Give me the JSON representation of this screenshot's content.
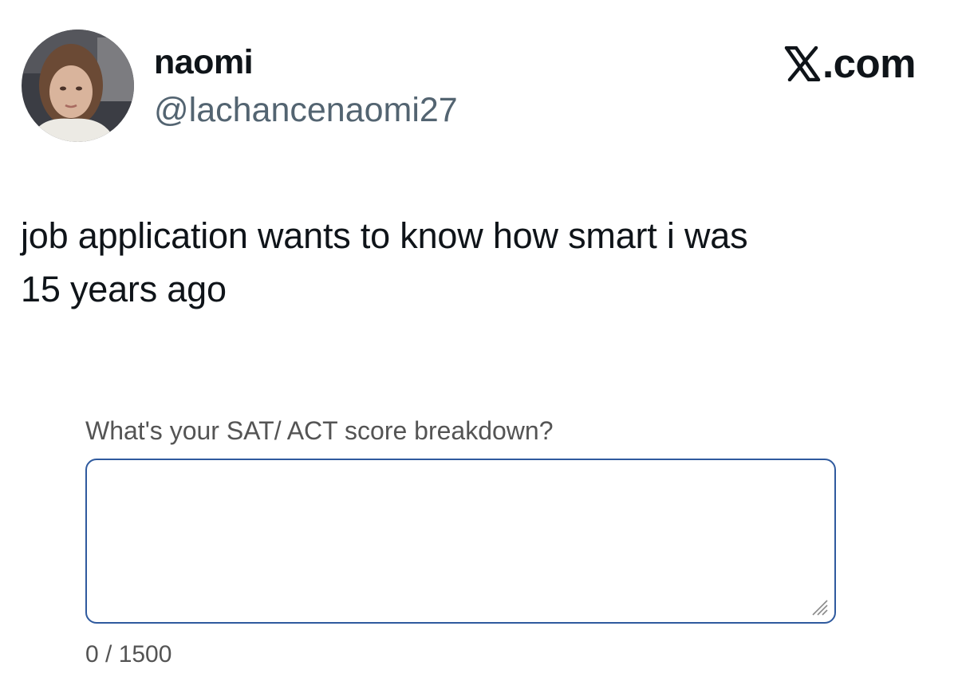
{
  "author": {
    "display_name": "naomi",
    "handle": "@lachancenaomi27"
  },
  "brand": {
    "label": ".com",
    "icon": "x-logo-icon"
  },
  "tweet": {
    "line1": "job application wants to know how smart i was",
    "line2": "15 years ago"
  },
  "form": {
    "question_label": "What's your SAT/ ACT score breakdown?",
    "answer_value": "",
    "char_count": "0 / 1500"
  },
  "colors": {
    "text": "#0f1419",
    "handle": "#536471",
    "form_label": "#545454",
    "field_border": "#2f5a9e"
  }
}
